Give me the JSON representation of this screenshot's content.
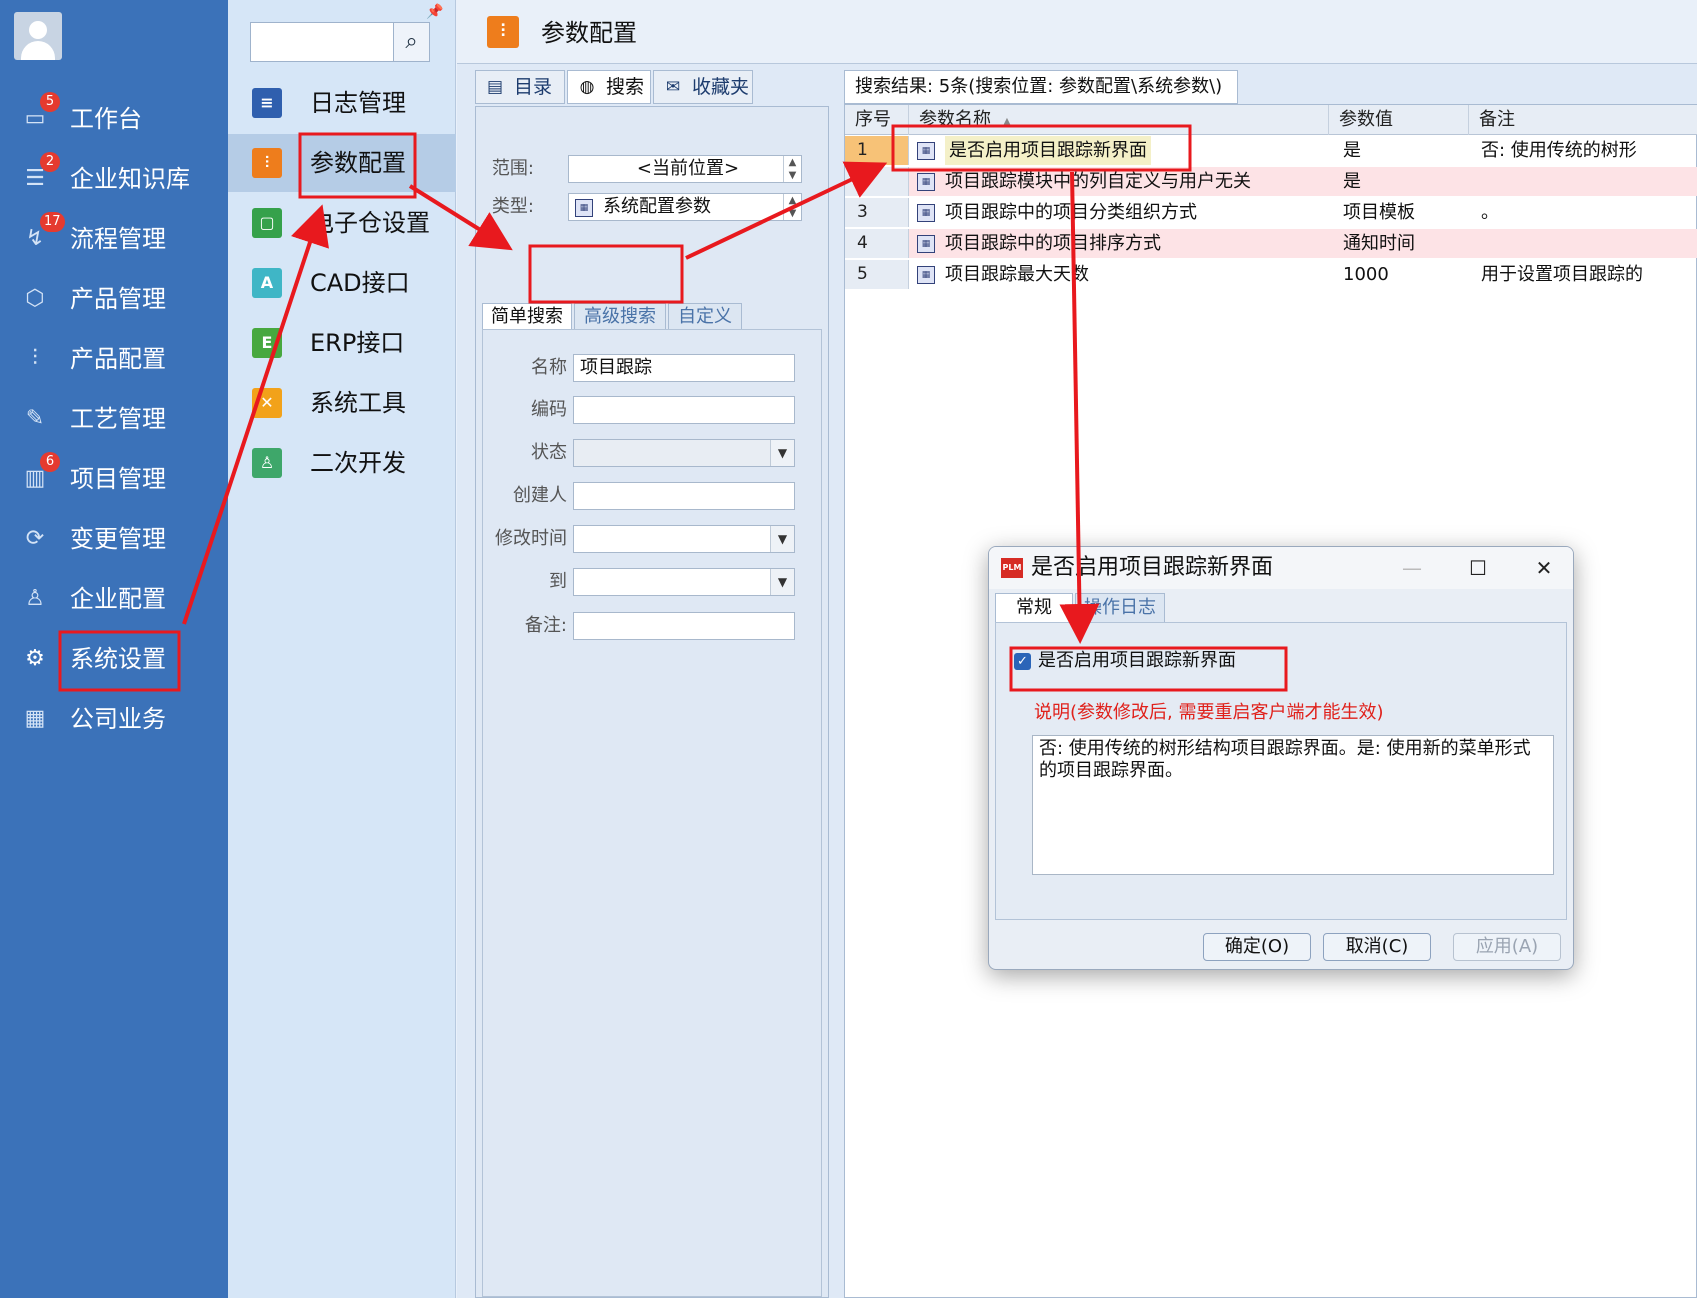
{
  "sidebar": {
    "items": [
      {
        "label": "工作台",
        "icon": "monitor-icon",
        "glyph": "▭",
        "badge": "5"
      },
      {
        "label": "企业知识库",
        "icon": "book-icon",
        "glyph": "☰",
        "badge": "2"
      },
      {
        "label": "流程管理",
        "icon": "flow-icon",
        "glyph": "↯",
        "badge": "17"
      },
      {
        "label": "产品管理",
        "icon": "cube-icon",
        "glyph": "⬡",
        "badge": ""
      },
      {
        "label": "产品配置",
        "icon": "sliders-icon",
        "glyph": "⫶",
        "badge": ""
      },
      {
        "label": "工艺管理",
        "icon": "wrench-icon",
        "glyph": "✎",
        "badge": ""
      },
      {
        "label": "项目管理",
        "icon": "chart-icon",
        "glyph": "▥",
        "badge": "6"
      },
      {
        "label": "变更管理",
        "icon": "refresh-icon",
        "glyph": "⟳",
        "badge": ""
      },
      {
        "label": "企业配置",
        "icon": "users-icon",
        "glyph": "♙",
        "badge": ""
      },
      {
        "label": "系统设置",
        "icon": "gear-icon",
        "glyph": "⚙",
        "badge": ""
      },
      {
        "label": "公司业务",
        "icon": "grid-icon",
        "glyph": "▦",
        "badge": ""
      }
    ]
  },
  "submenu": {
    "items": [
      {
        "label": "日志管理",
        "icon": "log-icon",
        "glyph": "≡",
        "color": "#2f5fae"
      },
      {
        "label": "参数配置",
        "icon": "params-icon",
        "glyph": "⫶",
        "color": "#ee7d1c"
      },
      {
        "label": "电子仓设置",
        "icon": "warehouse-icon",
        "glyph": "▢",
        "color": "#35a14b"
      },
      {
        "label": "CAD接口",
        "icon": "cad-icon",
        "glyph": "A",
        "color": "#3fb6c6"
      },
      {
        "label": "ERP接口",
        "icon": "erp-icon",
        "glyph": "E",
        "color": "#47a83f"
      },
      {
        "label": "系统工具",
        "icon": "tools-icon",
        "glyph": "✕",
        "color": "#f2a21a"
      },
      {
        "label": "二次开发",
        "icon": "dev-icon",
        "glyph": "♙",
        "color": "#3ea76a"
      }
    ]
  },
  "main": {
    "title": "参数配置",
    "top_tabs": [
      {
        "label": "目录",
        "icon": "catalog-icon",
        "glyph": "▤"
      },
      {
        "label": "搜索",
        "icon": "search-globe-icon",
        "glyph": "◍"
      },
      {
        "label": "收藏夹",
        "icon": "favorites-icon",
        "glyph": "✉"
      }
    ],
    "scope_label": "范围:",
    "scope_value": "<当前位置>",
    "type_label": "类型:",
    "type_value": "系统配置参数",
    "sub_tabs": [
      "简单搜索",
      "高级搜索",
      "自定义"
    ],
    "form": {
      "name_label": "名称",
      "name_value": "项目跟踪",
      "code_label": "编码",
      "status_label": "状态",
      "creator_label": "创建人",
      "modified_label": "修改时间",
      "to_label": "到",
      "remark_label": "备注:"
    }
  },
  "results": {
    "tab_label": "搜索结果: 5条(搜索位置: 参数配置\\系统参数\\)",
    "columns": [
      "序号",
      "参数名称",
      "参数值",
      "备注"
    ],
    "sort_glyph": "▲",
    "rows": [
      {
        "seq": "1",
        "name": "是否启用项目跟踪新界面",
        "value": "是",
        "note": "否: 使用传统的树形"
      },
      {
        "seq": "2",
        "name": "项目跟踪模块中的列自定义与用户无关",
        "value": "是",
        "note": ""
      },
      {
        "seq": "3",
        "name": "项目跟踪中的项目分类组织方式",
        "value": "项目模板",
        "note": "。"
      },
      {
        "seq": "4",
        "name": "项目跟踪中的项目排序方式",
        "value": "通知时间",
        "note": ""
      },
      {
        "seq": "5",
        "name": "项目跟踪最大天数",
        "value": "1000",
        "note": "用于设置项目跟踪的"
      }
    ]
  },
  "dialog": {
    "title": "是否启用项目跟踪新界面",
    "logo_text": "PLM",
    "minimize_glyph": "—",
    "maximize_glyph": "☐",
    "close_glyph": "✕",
    "tabs": [
      "常规",
      "操作日志"
    ],
    "checkbox_label": "是否启用项目跟踪新界面",
    "checkbox_checked": true,
    "hint": "说明(参数修改后, 需要重启客户端才能生效)",
    "description": "否: 使用传统的树形结构项目跟踪界面。是: 使用新的菜单形式的项目跟踪界面。",
    "ok_label": "确定(O)",
    "cancel_label": "取消(C)",
    "apply_label": "应用(A)"
  },
  "colors": {
    "sidebar_bg": "#3b72b9",
    "annotation_red": "#e8191e",
    "current_row": "#f7c277",
    "alt_row": "#fde3e6"
  }
}
